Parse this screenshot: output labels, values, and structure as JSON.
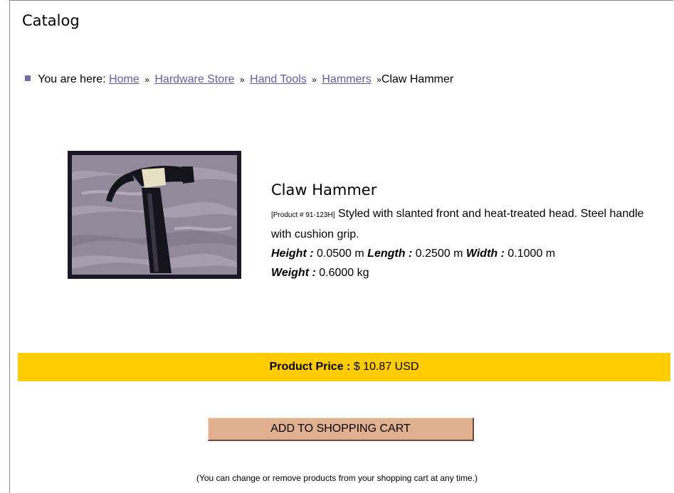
{
  "page": {
    "title": "Catalog"
  },
  "breadcrumb": {
    "prefix": "You are here:",
    "separator": "»",
    "links": [
      "Home",
      "Hardware Store",
      "Hand Tools",
      "Hammers"
    ],
    "current": "Claw Hammer"
  },
  "product": {
    "name": "Claw Hammer",
    "sku": "[Product # 91-123H]",
    "description": "Styled with slanted front and heat-treated head. Steel handle with cushion grip.",
    "height_label": "Height :",
    "height_value": "0.0500 m",
    "length_label": "Length :",
    "length_value": "0.2500 m",
    "width_label": "Width :",
    "width_value": "0.1000 m",
    "weight_label": "Weight :",
    "weight_value": "0.6000 kg",
    "image_icon": "claw-hammer-photo"
  },
  "price": {
    "label": "Product Price :",
    "value": "$ 10.87 USD"
  },
  "cart": {
    "button_label": "ADD TO SHOPPING CART",
    "note": "(You can change or remove products from your shopping cart at any time.)"
  },
  "colors": {
    "price_bar": "#ffcc00",
    "button": "#e0b090",
    "link": "#6a5a9a"
  }
}
